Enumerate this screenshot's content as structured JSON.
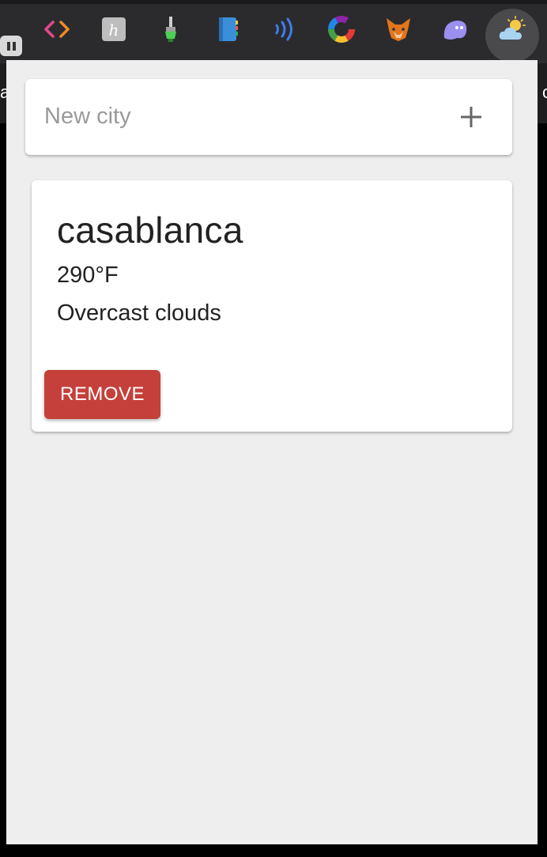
{
  "toolbar": {
    "extensions": [
      {
        "icon": "code-brackets-icon",
        "colors": [
          "#e8478c",
          "#f08a24"
        ]
      },
      {
        "icon": "h-badge-icon",
        "color": "#bdbdbd",
        "letter": "h"
      },
      {
        "icon": "brush-icon",
        "color": "#4ccf55"
      },
      {
        "icon": "notebook-icon",
        "color": "#3b8fd8"
      },
      {
        "icon": "wireless-icon",
        "color": "#3d7de8"
      },
      {
        "icon": "color-wheel-icon"
      },
      {
        "icon": "fox-icon",
        "color": "#e2761b"
      },
      {
        "icon": "ghost-icon",
        "color": "#9b8ff0"
      },
      {
        "icon": "weather-cloud-sun-icon",
        "active": true
      }
    ]
  },
  "new_city": {
    "placeholder": "New city",
    "value": ""
  },
  "cities": [
    {
      "name": "casablanca",
      "temperature": "290°F",
      "description": "Overcast clouds",
      "remove_label": "REMOVE"
    }
  ],
  "colors": {
    "remove_button": "#c5403a",
    "popup_background": "#eeeeee",
    "card_background": "#ffffff"
  }
}
